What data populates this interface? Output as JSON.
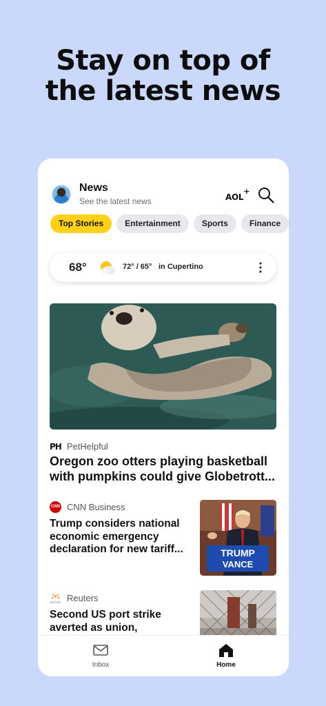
{
  "headline": {
    "line1": "Stay on top of",
    "line2": "the latest news"
  },
  "header": {
    "title": "News",
    "subtitle": "See the latest news",
    "brand": "AOL",
    "brand_plus": "+"
  },
  "tabs": [
    {
      "label": "Top Stories",
      "active": true
    },
    {
      "label": "Entertainment"
    },
    {
      "label": "Sports"
    },
    {
      "label": "Finance"
    }
  ],
  "weather": {
    "temp": "68°",
    "range": "72° / 65°",
    "location": "in Cupertino",
    "icon": "partly-sunny-icon"
  },
  "stories": [
    {
      "source_logo": "PH",
      "source": "PetHelpful",
      "title": "Oregon zoo otters playing basketball with pumpkins could give Globetrott..."
    },
    {
      "source_logo": "CNN",
      "source": "CNN Business",
      "title": "Trump considers national economic emergency declaration for new tariff...",
      "thumb_text_1": "TRUMP",
      "thumb_text_2": "VANCE"
    },
    {
      "source_logo": "REUTERS",
      "source": "Reuters",
      "title": "Second US port strike averted as union,"
    }
  ],
  "nav": {
    "inbox": "Inbox",
    "home": "Home"
  },
  "colors": {
    "background": "#c9d8fb",
    "accent_tab": "#ffd11a",
    "cnn_red": "#cc0000"
  }
}
